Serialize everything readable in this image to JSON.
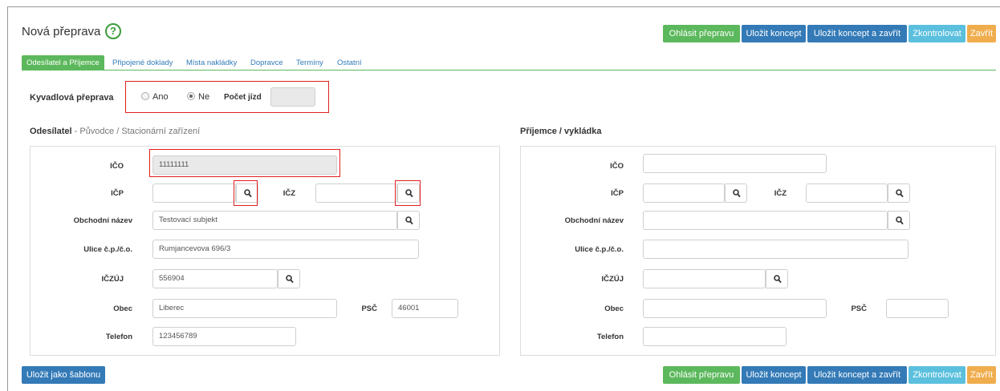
{
  "page": {
    "title": "Nová přeprava",
    "help_glyph": "?"
  },
  "actions": {
    "report": "Ohlásit přepravu",
    "save_draft": "Uložit koncept",
    "save_draft_close": "Uložit koncept a zavřít",
    "check": "Zkontrolovat",
    "close": "Zavřít",
    "save_template": "Uložit jako šablonu"
  },
  "tabs": [
    {
      "label": "Odesílatel a Příjemce",
      "active": true
    },
    {
      "label": "Připojené doklady"
    },
    {
      "label": "Místa nakládky"
    },
    {
      "label": "Dopravce"
    },
    {
      "label": "Termíny"
    },
    {
      "label": "Ostatní"
    }
  ],
  "shuttle": {
    "label": "Kyvadlová přeprava",
    "yes": "Ano",
    "no": "Ne",
    "selected": "Ne",
    "trips_label": "Počet jízd",
    "trips_value": ""
  },
  "sender": {
    "heading": "Odesílatel",
    "subheading": " - Původce / Stacionární zařízení",
    "labels": {
      "ico": "IČO",
      "icp": "IČP",
      "icz": "IČZ",
      "name": "Obchodní název",
      "street": "Ulice č.p./č.o.",
      "iczuj": "IČZÚJ",
      "city": "Obec",
      "zip": "PSČ",
      "phone": "Telefon"
    },
    "values": {
      "ico": "11111111",
      "icp": "",
      "icz": "",
      "name": "Testovací subjekt",
      "street": "Rumjancevova 696/3",
      "iczuj": "556904",
      "city": "Liberec",
      "zip": "46001",
      "phone": "123456789"
    }
  },
  "recipient": {
    "heading": "Příjemce / vykládka",
    "labels": {
      "ico": "IČO",
      "icp": "IČP",
      "icz": "IČZ",
      "name": "Obchodní název",
      "street": "Ulice č.p./č.o.",
      "iczuj": "IČZÚJ",
      "city": "Obec",
      "zip": "PSČ",
      "phone": "Telefon"
    },
    "values": {
      "ico": "",
      "icp": "",
      "icz": "",
      "name": "",
      "street": "",
      "iczuj": "",
      "city": "",
      "zip": "",
      "phone": ""
    }
  },
  "colors": {
    "green": "#5cb85c",
    "blue": "#337ab7",
    "cyan": "#5bc0de",
    "orange": "#f0ad4e",
    "highlight": "#e02020"
  }
}
